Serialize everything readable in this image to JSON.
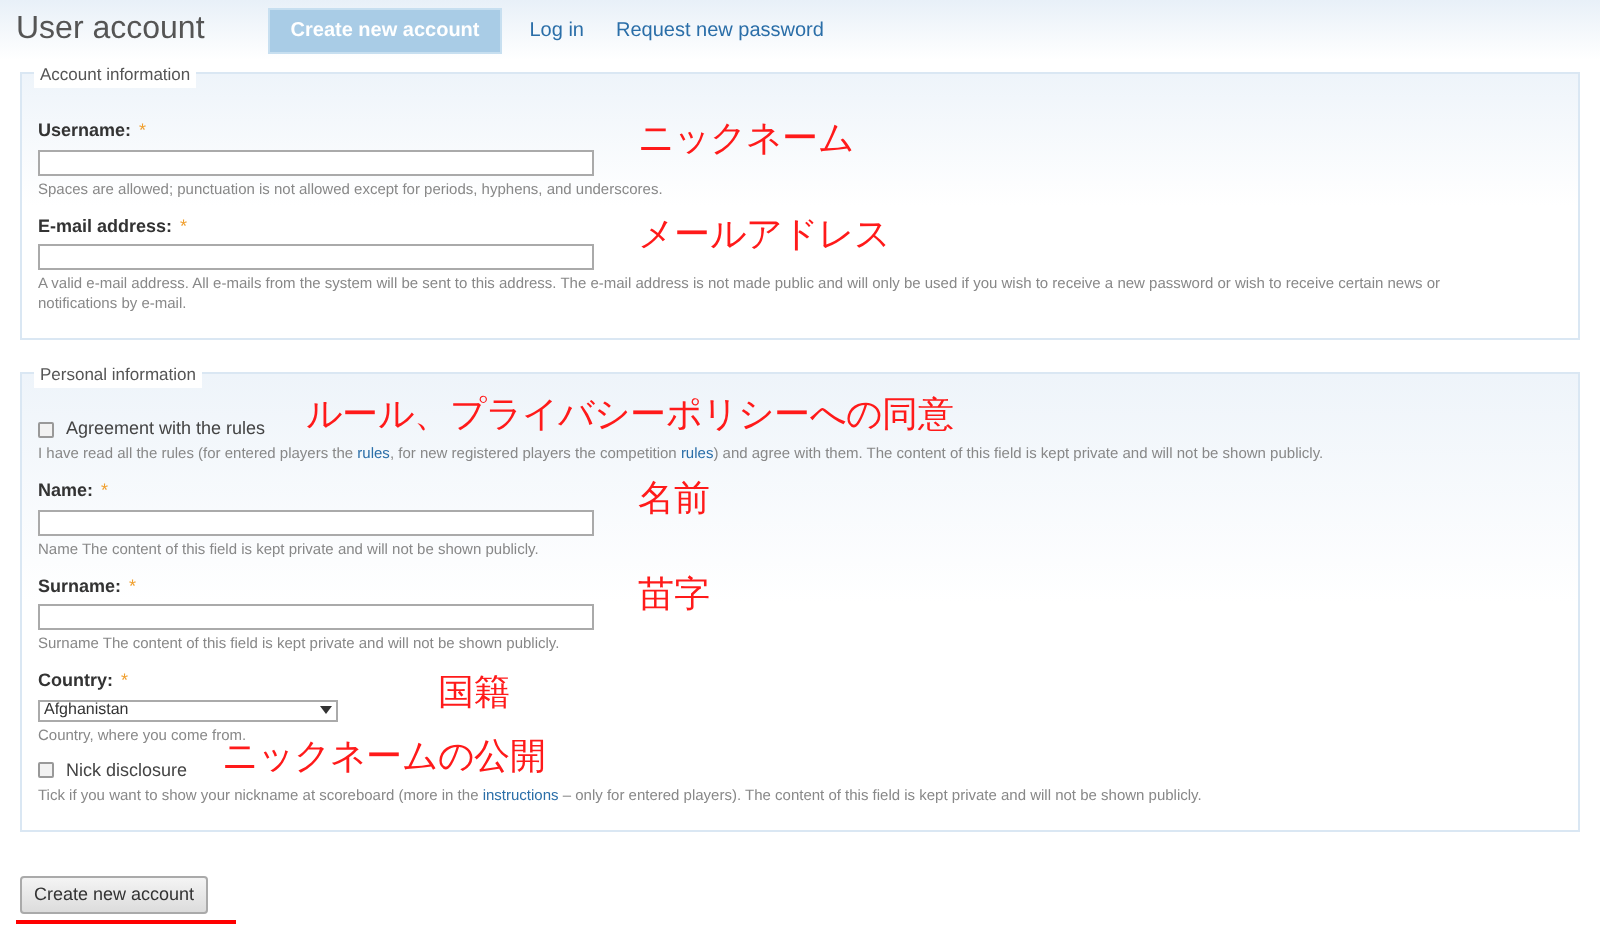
{
  "page": {
    "title": "User account"
  },
  "tabs": [
    {
      "label": "Create new account",
      "selected": true
    },
    {
      "label": "Log in",
      "selected": false
    },
    {
      "label": "Request new password",
      "selected": false
    }
  ],
  "fieldsets": [
    {
      "legend": "Account information",
      "fields": [
        {
          "kind": "text",
          "label": "Username:",
          "required_mark": "*",
          "description": [
            {
              "text": "Spaces are allowed; punctuation is not allowed except for periods, hyphens, and underscores.",
              "link": false
            }
          ],
          "annotation": "ニックネーム"
        },
        {
          "kind": "text",
          "label": "E-mail address:",
          "required_mark": "*",
          "description": [
            {
              "text": "A valid e-mail address. All e-mails from the system will be sent to this address. The e-mail address is not made public and will only be used if you wish to receive a new password or wish to receive certain news or notifications by e-mail.",
              "link": false
            }
          ],
          "annotation": "メールアドレス"
        }
      ]
    },
    {
      "legend": "Personal information",
      "fields": [
        {
          "kind": "checkbox",
          "label": "Agreement with the rules",
          "checked": false,
          "description": [
            {
              "text": "I have read all the rules (for entered players the ",
              "link": false
            },
            {
              "text": "rules",
              "link": true
            },
            {
              "text": ", for new registered players the competition ",
              "link": false
            },
            {
              "text": "rules",
              "link": true
            },
            {
              "text": ") and agree with them. The content of this field is kept private and will not be shown publicly.",
              "link": false
            }
          ],
          "annotation": "ルール、プライバシーポリシーへの同意"
        },
        {
          "kind": "text",
          "label": "Name:",
          "required_mark": "*",
          "description": [
            {
              "text": "Name The content of this field is kept private and will not be shown publicly.",
              "link": false
            }
          ],
          "annotation": "名前"
        },
        {
          "kind": "text",
          "label": "Surname:",
          "required_mark": "*",
          "description": [
            {
              "text": "Surname The content of this field is kept private and will not be shown publicly.",
              "link": false
            }
          ],
          "annotation": "苗字"
        },
        {
          "kind": "select",
          "label": "Country:",
          "required_mark": "*",
          "value": "Afghanistan",
          "description": [
            {
              "text": "Country, where you come from.",
              "link": false
            }
          ],
          "annotation": "国籍"
        },
        {
          "kind": "checkbox",
          "label": "Nick disclosure",
          "checked": false,
          "description": [
            {
              "text": "Tick if you want to show your nickname at scoreboard (more in the ",
              "link": false
            },
            {
              "text": "instructions",
              "link": true
            },
            {
              "text": " – only for entered players). The content of this field is kept private and will not be shown publicly.",
              "link": false
            }
          ],
          "annotation": "ニックネームの公開"
        }
      ]
    }
  ],
  "submit": {
    "label": "Create new account"
  }
}
